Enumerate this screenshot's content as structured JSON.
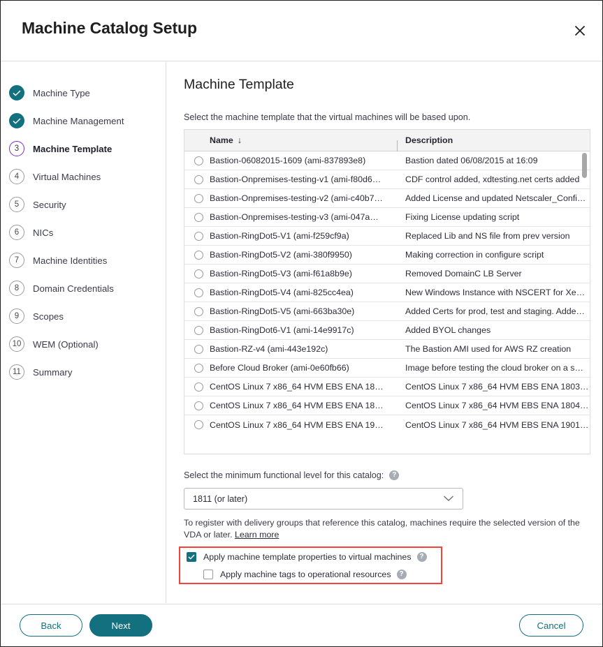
{
  "window": {
    "title": "Machine Catalog Setup",
    "close_icon": "close-icon"
  },
  "colors": {
    "accent_teal": "#13707f",
    "active_step_purple": "#7b2fbe",
    "highlight_red": "#f4433b",
    "header_grey": "#f3f3f3"
  },
  "sidebar": {
    "steps": [
      {
        "marker": "✓",
        "label": "Machine Type",
        "state": "done"
      },
      {
        "marker": "✓",
        "label": "Machine Management",
        "state": "done"
      },
      {
        "marker": "3",
        "label": "Machine Template",
        "state": "current"
      },
      {
        "marker": "4",
        "label": "Virtual Machines",
        "state": "pending"
      },
      {
        "marker": "5",
        "label": "Security",
        "state": "pending"
      },
      {
        "marker": "6",
        "label": "NICs",
        "state": "pending"
      },
      {
        "marker": "7",
        "label": "Machine Identities",
        "state": "pending"
      },
      {
        "marker": "8",
        "label": "Domain Credentials",
        "state": "pending"
      },
      {
        "marker": "9",
        "label": "Scopes",
        "state": "pending"
      },
      {
        "marker": "10",
        "label": "WEM (Optional)",
        "state": "pending"
      },
      {
        "marker": "11",
        "label": "Summary",
        "state": "pending"
      }
    ]
  },
  "main": {
    "title": "Machine Template",
    "subtitle": "Select the machine template that the virtual machines will be based upon.",
    "table": {
      "columns": [
        {
          "label": "Name",
          "sort": "↓"
        },
        {
          "label": "Description",
          "sort": ""
        }
      ],
      "rows": [
        {
          "name": "Bastion-06082015-1609 (ami-837893e8)",
          "description": "Bastion dated 06/08/2015 at 16:09",
          "selected": false
        },
        {
          "name": "Bastion-Onpremises-testing-v1 (ami-f80d6…",
          "description": "CDF control added, xdtesting.net certs added",
          "selected": false
        },
        {
          "name": "Bastion-Onpremises-testing-v2 (ami-c40b7…",
          "description": "Added License and updated Netscaler_Confi…",
          "selected": false
        },
        {
          "name": "Bastion-Onpremises-testing-v3 (ami-047a…",
          "description": "Fixing License updating script",
          "selected": false
        },
        {
          "name": "Bastion-RingDot5-V1 (ami-f259cf9a)",
          "description": "Replaced Lib and NS file from prev version",
          "selected": false
        },
        {
          "name": "Bastion-RingDot5-V2 (ami-380f9950)",
          "description": "Making correction in configure script",
          "selected": false
        },
        {
          "name": "Bastion-RingDot5-V3 (ami-f61a8b9e)",
          "description": "Removed DomainC LB Server",
          "selected": false
        },
        {
          "name": "Bastion-RingDot5-V4 (ami-825cc4ea)",
          "description": "New Windows Instance with NSCERT for Xe…",
          "selected": false
        },
        {
          "name": "Bastion-RingDot5-V5 (ami-663ba30e)",
          "description": "Added Certs for prod, test and staging. Adde…",
          "selected": false
        },
        {
          "name": "Bastion-RingDot6-V1 (ami-14e9917c)",
          "description": "Added BYOL changes",
          "selected": false
        },
        {
          "name": "Bastion-RZ-v4 (ami-443e192c)",
          "description": "The Bastion AMI used for AWS RZ creation",
          "selected": false
        },
        {
          "name": "Before Cloud Broker (ami-0e60fb66)",
          "description": "Image before testing the cloud broker on a s…",
          "selected": false
        },
        {
          "name": "CentOS Linux 7 x86_64 HVM EBS ENA 18…",
          "description": "CentOS Linux 7 x86_64 HVM EBS ENA 1803…",
          "selected": false
        },
        {
          "name": "CentOS Linux 7 x86_64 HVM EBS ENA 18…",
          "description": "CentOS Linux 7 x86_64 HVM EBS ENA 1804…",
          "selected": false
        },
        {
          "name": "CentOS Linux 7 x86_64 HVM EBS ENA 19…",
          "description": "CentOS Linux 7 x86_64 HVM EBS ENA 1901…",
          "selected": false
        }
      ]
    },
    "functional_level": {
      "label": "Select the minimum functional level for this catalog:",
      "help": "?",
      "selected": "1811 (or later)"
    },
    "note": {
      "text": "To register with delivery groups that reference this catalog, machines require the selected version of the VDA or later. ",
      "link": "Learn more"
    },
    "options": [
      {
        "label": "Apply machine template properties to virtual machines",
        "checked": true,
        "help": "?"
      },
      {
        "label": "Apply machine tags to operational resources",
        "checked": false,
        "help": "?"
      }
    ]
  },
  "footer": {
    "back": "Back",
    "next": "Next",
    "cancel": "Cancel"
  }
}
